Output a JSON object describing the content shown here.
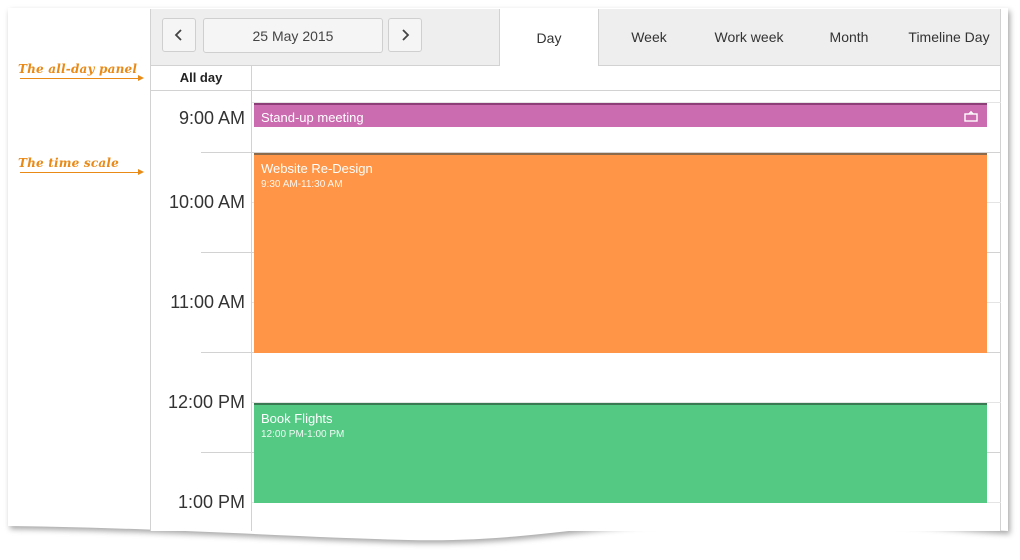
{
  "callouts": {
    "all_day_panel": "The all-day panel",
    "time_scale": "The time scale"
  },
  "toolbar": {
    "prev_icon": "chevron-left-icon",
    "next_icon": "chevron-right-icon",
    "date": "25 May 2015",
    "views": [
      {
        "label": "Day",
        "active": true
      },
      {
        "label": "Week",
        "active": false
      },
      {
        "label": "Work week",
        "active": false
      },
      {
        "label": "Month",
        "active": false
      },
      {
        "label": "Timeline Day",
        "active": false
      }
    ]
  },
  "allday": {
    "label": "All day"
  },
  "time_scale": [
    "9:00 AM",
    "10:00 AM",
    "11:00 AM",
    "12:00 PM",
    "1:00 PM"
  ],
  "appointments": [
    {
      "subject": "Stand-up meeting",
      "interval": "",
      "color": "#cc6cb0",
      "recurring": true,
      "recur_icon": "recurrence-icon"
    },
    {
      "subject": "Website Re-Design",
      "interval": "9:30 AM-11:30 AM",
      "color": "#ff9546",
      "recurring": false
    },
    {
      "subject": "Book Flights",
      "interval": "12:00 PM-1:00 PM",
      "color": "#54c984",
      "recurring": false
    }
  ],
  "colors": {
    "callout": "#e98a17",
    "toolbar_bg": "#eeeeee",
    "border": "#d2d2d2"
  }
}
